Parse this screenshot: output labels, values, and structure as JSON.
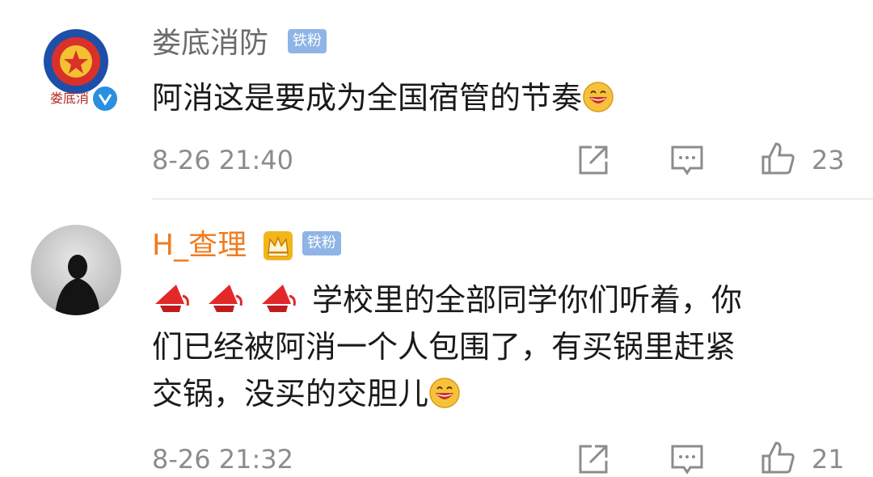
{
  "comments": [
    {
      "username": "娄底消防",
      "badge": "铁粉",
      "avatar_text": "娄底消",
      "text": "阿消这是要成为全国宿管的节奏",
      "timestamp": "8-26 21:40",
      "likes": "23"
    },
    {
      "username": "H_查理",
      "badge": "铁粉",
      "text_line1": "学校里的全部同学你们听着，你",
      "text_line2": "们已经被阿消一个人包围了，有买锅里赶紧",
      "text_line3": "交锅，没买的交胆儿",
      "timestamp": "8-26 21:32",
      "likes": "21"
    }
  ],
  "colors": {
    "vip_name": "#f07b20",
    "fan_badge": "#8fb4e6",
    "verified": "#2a8fe0"
  }
}
